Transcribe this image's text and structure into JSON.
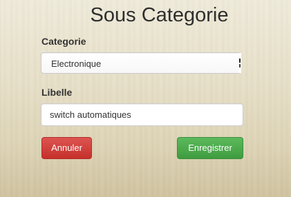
{
  "page": {
    "title": "Sous Categorie"
  },
  "form": {
    "categorie": {
      "label": "Categorie",
      "selected": "Electronique",
      "icon": "dropdown-arrow-icon"
    },
    "libelle": {
      "label": "Libelle",
      "value": "switch automatiques"
    }
  },
  "actions": {
    "cancel_label": "Annuler",
    "save_label": "Enregistrer",
    "colors": {
      "cancel": "#c9302c",
      "save": "#449d44"
    }
  }
}
